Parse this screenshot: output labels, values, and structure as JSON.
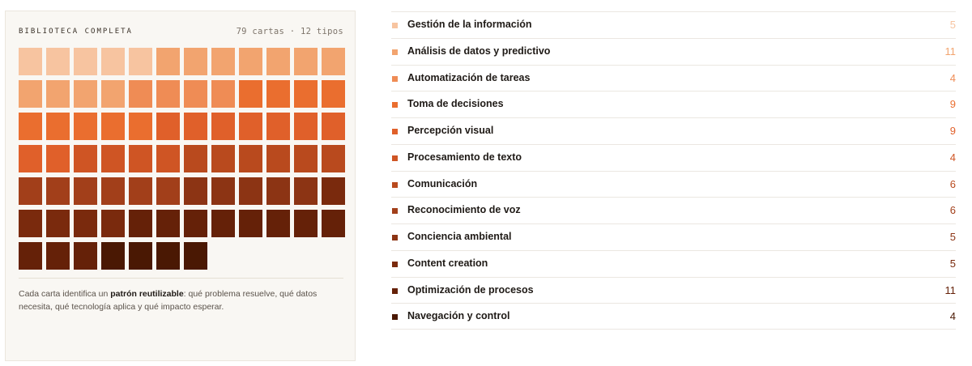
{
  "library": {
    "title": "BIBLIOTECA COMPLETA",
    "meta": "79 cartas · 12 tipos",
    "desc_before": "Cada carta identifica un ",
    "desc_bold": "patrón reutilizable",
    "desc_after": ": qué problema resuelve, qué datos necesita, qué tecnología aplica y qué impacto esperar."
  },
  "categories": [
    {
      "name": "Gestión de la información",
      "count": "5",
      "color": "#f7c4a0"
    },
    {
      "name": "Análisis de datos y predictivo",
      "count": "11",
      "color": "#f2a46f"
    },
    {
      "name": "Automatización de tareas",
      "count": "4",
      "color": "#ef8c55"
    },
    {
      "name": "Toma de decisiones",
      "count": "9",
      "color": "#ea6e2f"
    },
    {
      "name": "Percepción visual",
      "count": "9",
      "color": "#e0602a"
    },
    {
      "name": "Procesamiento de texto",
      "count": "4",
      "color": "#cf5524"
    },
    {
      "name": "Comunicación",
      "count": "6",
      "color": "#b94a1e"
    },
    {
      "name": "Reconocimiento de voz",
      "count": "6",
      "color": "#a23f1a"
    },
    {
      "name": "Conciencia ambiental",
      "count": "5",
      "color": "#8c3414"
    },
    {
      "name": "Content creation",
      "count": "5",
      "color": "#7a2a0d"
    },
    {
      "name": "Optimización de procesos",
      "count": "11",
      "color": "#652108"
    },
    {
      "name": "Navegación y control",
      "count": "4",
      "color": "#4a1803"
    }
  ]
}
